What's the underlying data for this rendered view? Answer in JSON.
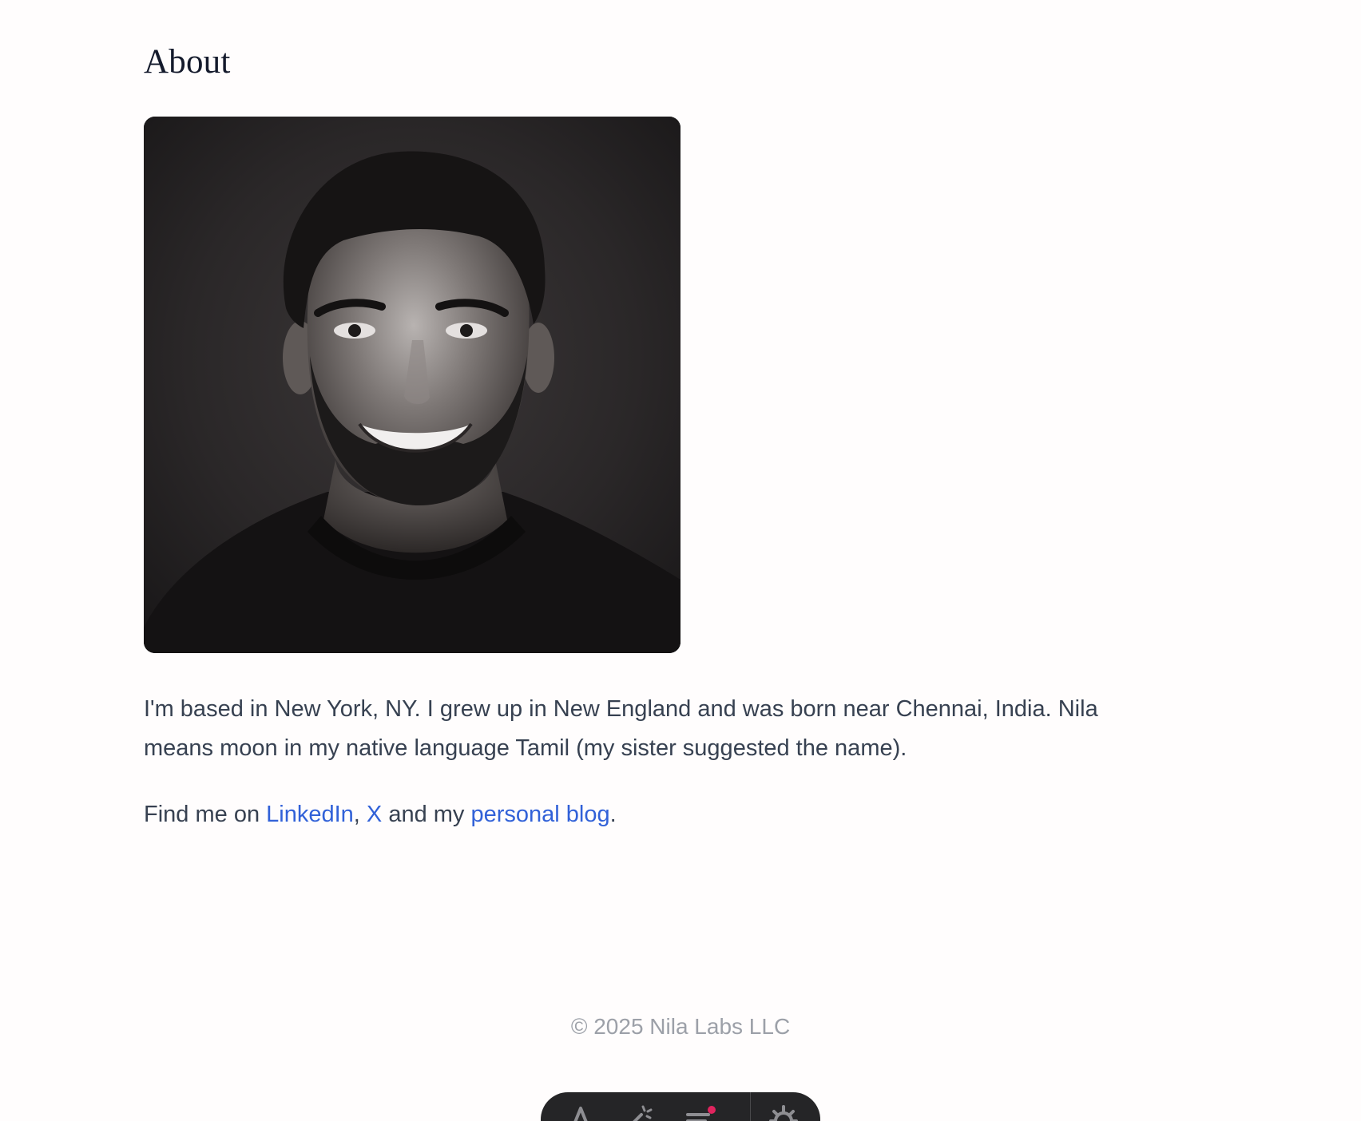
{
  "about": {
    "title": "About"
  },
  "portrait": {
    "alt": "Black-and-white portrait photo"
  },
  "bio": {
    "text": "I'm based in New York, NY. I grew up in New England and was born near Chennai, India. Nila means moon in my native language Tamil (my sister suggested the name)."
  },
  "find": {
    "prefix": "Find me on ",
    "linkedin": "LinkedIn",
    "comma": ", ",
    "x": "X",
    "and_my": " and my ",
    "blog": "personal blog",
    "period": "."
  },
  "footer": {
    "copyright": "© 2025 Nila Labs LLC"
  },
  "dock": {
    "icons": [
      "text-icon",
      "wand-icon",
      "menu-icon",
      "gear-icon"
    ],
    "notification_color": "#e0245e"
  },
  "colors": {
    "link": "#3161d8",
    "heading": "#141a2c",
    "body_text": "#374151",
    "footer_text": "#9ca0a8"
  }
}
